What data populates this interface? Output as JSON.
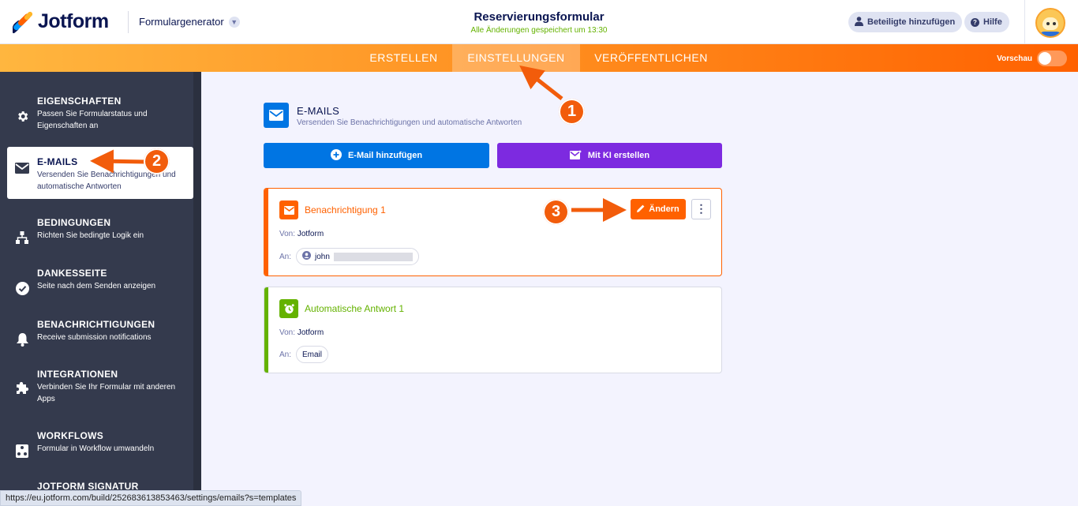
{
  "header": {
    "brand": "Jotform",
    "form_generator": "Formulargenerator",
    "form_title": "Reservierungsformular",
    "save_status": "Alle Änderungen gespeichert um 13:30",
    "add_collaborators": "Beteiligte hinzufügen",
    "help": "Hilfe"
  },
  "nav": {
    "tabs": [
      "ERSTELLEN",
      "EINSTELLUNGEN",
      "VERÖFFENTLICHEN"
    ],
    "active_tab": "EINSTELLUNGEN",
    "preview_label": "Vorschau",
    "preview_on": false
  },
  "sidebar": {
    "items": [
      {
        "title": "EIGENSCHAFTEN",
        "desc": "Passen Sie Formularstatus und Eigenschaften an",
        "icon": "gear-icon"
      },
      {
        "title": "E-MAILS",
        "desc": "Versenden Sie Benachrichtigungen und automatische Antworten",
        "icon": "envelope-icon"
      },
      {
        "title": "BEDINGUNGEN",
        "desc": "Richten Sie bedingte Logik ein",
        "icon": "sitemap-icon"
      },
      {
        "title": "DANKESSEITE",
        "desc": "Seite nach dem Senden anzeigen",
        "icon": "check-circle-icon"
      },
      {
        "title": "BENACHRICHTIGUNGEN",
        "desc": "Receive submission notifications",
        "icon": "bell-icon"
      },
      {
        "title": "INTEGRATIONEN",
        "desc": "Verbinden Sie Ihr Formular mit anderen Apps",
        "icon": "puzzle-icon"
      },
      {
        "title": "WORKFLOWS",
        "desc": "Formular in Workflow umwandeln",
        "icon": "workflow-icon"
      },
      {
        "title": "JOTFORM SIGNATUR",
        "desc": "",
        "icon": "signature-icon"
      }
    ],
    "active_index": 1
  },
  "main": {
    "section_title": "E-MAILS",
    "section_subtitle": "Versenden Sie Benachrichtigungen und automatische Antworten",
    "add_email_button": "E-Mail hinzufügen",
    "ai_button": "Mit KI erstellen",
    "cards": [
      {
        "title": "Benachrichtigung 1",
        "from_label": "Von:",
        "from_value": "Jotform",
        "to_label": "An:",
        "to_value": "john",
        "edit_label": "Ändern",
        "accent": "#ff6100"
      },
      {
        "title": "Automatische Antwort 1",
        "from_label": "Von:",
        "from_value": "Jotform",
        "to_label": "An:",
        "to_value": "Email",
        "accent": "#64b200"
      }
    ]
  },
  "annotations": [
    "1",
    "2",
    "3"
  ],
  "statusbar": {
    "url": "https://eu.jotform.com/build/252683613853463/settings/emails?s=templates"
  },
  "colors": {
    "brand_navy": "#0a1551",
    "orange": "#ff6100",
    "blue": "#0075e3",
    "purple": "#7d2ae0",
    "green": "#64b200",
    "sidebar_bg": "#343a4d",
    "annotation": "#f25c0b"
  }
}
